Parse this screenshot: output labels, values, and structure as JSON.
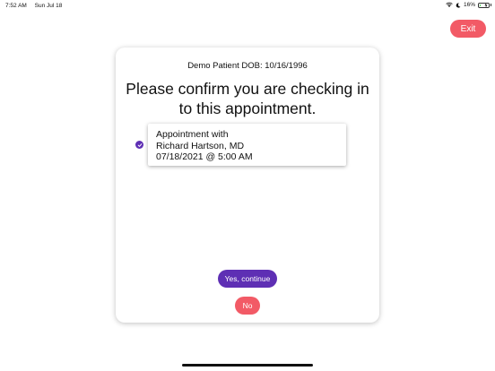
{
  "status_bar": {
    "time": "7:52 AM",
    "date": "Sun Jul 18",
    "battery_percent": "16%",
    "battery_level": 0.16,
    "icons": [
      "wifi-icon",
      "moon-icon",
      "battery-icon",
      "charging-icon"
    ]
  },
  "header": {
    "exit_label": "Exit"
  },
  "card": {
    "patient_line": "Demo Patient DOB: 10/16/1996",
    "heading_line1": "Please confirm you are checking in",
    "heading_line2": "to this appointment.",
    "appointment": {
      "line1": "Appointment with",
      "line2": "Richard Hartson, MD",
      "line3": "07/18/2021 @ 5:00 AM",
      "selected": true
    },
    "yes_label": "Yes, continue",
    "no_label": "No"
  },
  "colors": {
    "accent_purple": "#5e2fb4",
    "exit_red": "#f25a66"
  }
}
